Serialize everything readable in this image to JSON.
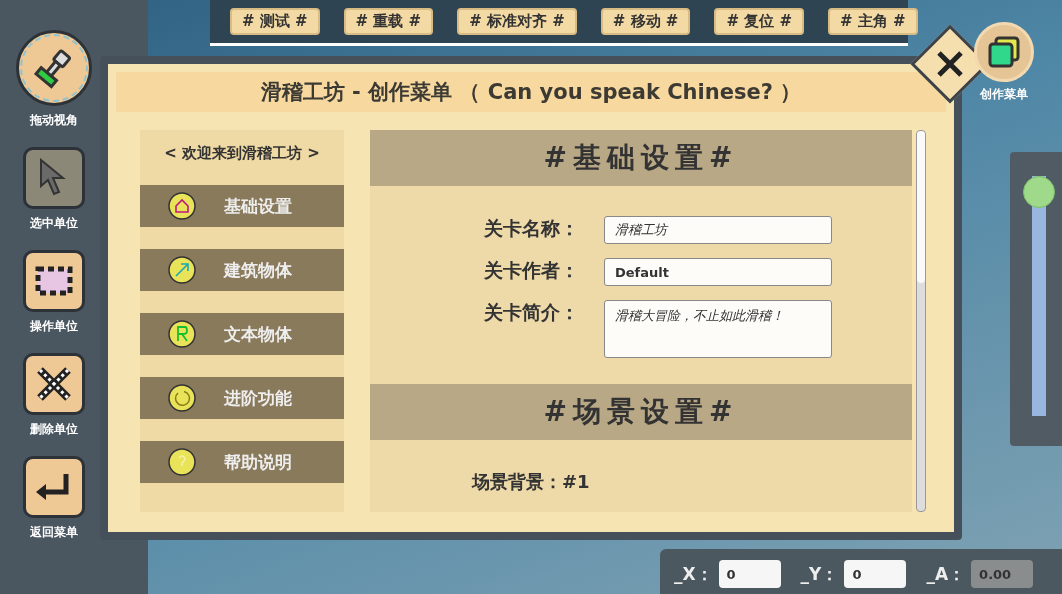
{
  "top_toolbar": [
    {
      "label": "# 测试 #"
    },
    {
      "label": "# 重载 #"
    },
    {
      "label": "# 标准对齐 #"
    },
    {
      "label": "# 移动 #"
    },
    {
      "label": "# 复位 #"
    },
    {
      "label": "# 主角 #"
    }
  ],
  "tools": [
    {
      "kind": "pan",
      "label": "拖动视角",
      "selected": true,
      "disabled": false
    },
    {
      "kind": "select",
      "label": "选中单位",
      "selected": false,
      "disabled": true
    },
    {
      "kind": "operate",
      "label": "操作单位",
      "selected": false,
      "disabled": false
    },
    {
      "kind": "delete",
      "label": "删除单位",
      "selected": false,
      "disabled": false
    },
    {
      "kind": "back",
      "label": "返回菜单",
      "selected": false,
      "disabled": false
    }
  ],
  "create_menu": {
    "label": "创作菜单"
  },
  "zoom_slider": {
    "level": 1
  },
  "dialog": {
    "title": "滑稽工坊 - 创作菜单 （ Can you speak Chinese? ）",
    "sidebar": {
      "heading": "< 欢迎来到滑稽工坊 >",
      "items": [
        {
          "kind": "house",
          "label": "基础设置"
        },
        {
          "kind": "arrow",
          "label": "建筑物体"
        },
        {
          "kind": "letter",
          "label": "文本物体"
        },
        {
          "kind": "ring",
          "label": "进阶功能"
        },
        {
          "kind": "question",
          "label": "帮助说明"
        }
      ]
    },
    "sections": [
      {
        "heading": "#基础设置#",
        "fields": [
          {
            "kind": "input",
            "label": "关卡名称：",
            "value": "滑稽工坊",
            "italic": true
          },
          {
            "kind": "input",
            "label": "关卡作者：",
            "value": "Default",
            "italic": false
          },
          {
            "kind": "textarea",
            "label": "关卡简介：",
            "value": "滑稽大冒险，不止如此滑稽！",
            "italic": true
          }
        ]
      },
      {
        "heading": "#场景设置#",
        "fields": [
          {
            "kind": "text",
            "label": "场景背景：#1"
          }
        ]
      }
    ]
  },
  "coordinates": [
    {
      "label": "_X：",
      "value": "0",
      "disabled": false
    },
    {
      "label": "_Y：",
      "value": "0",
      "disabled": false
    },
    {
      "label": "_A：",
      "value": "0.00",
      "disabled": true
    }
  ]
}
